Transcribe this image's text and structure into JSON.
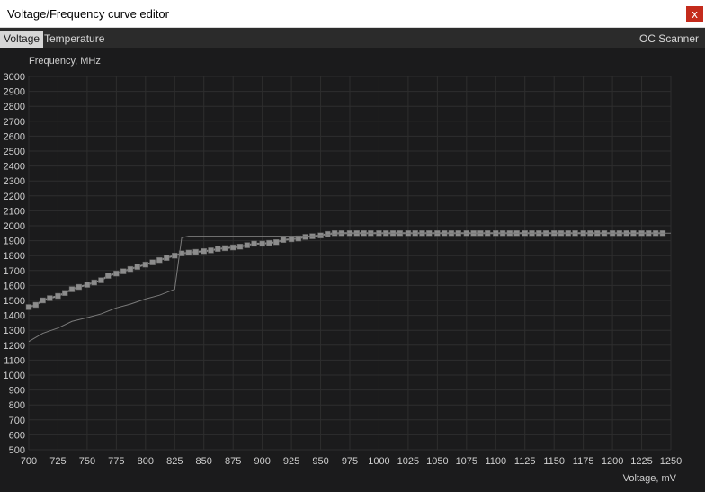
{
  "window": {
    "title": "Voltage/Frequency curve editor",
    "close_glyph": "x"
  },
  "tabs": {
    "voltage": "Voltage",
    "temperature": "Temperature",
    "oc_scanner": "OC Scanner"
  },
  "colors": {
    "background": "#1b1b1c",
    "grid": "#2e2e2e",
    "curve": "#8a8a8a",
    "marker": "#8c8c8c",
    "text": "#d0d0d0",
    "close": "#c42b1c"
  },
  "chart_data": {
    "type": "line",
    "ylabel": "Frequency, MHz",
    "xlabel": "Voltage, mV",
    "xlim": [
      700,
      1250
    ],
    "ylim": [
      500,
      3000
    ],
    "grid": true,
    "x_ticks": [
      700,
      725,
      750,
      775,
      800,
      825,
      850,
      875,
      900,
      925,
      950,
      975,
      1000,
      1025,
      1050,
      1075,
      1100,
      1125,
      1150,
      1175,
      1200,
      1225,
      1250
    ],
    "y_ticks": [
      500,
      600,
      700,
      800,
      900,
      1000,
      1100,
      1200,
      1300,
      1400,
      1500,
      1600,
      1700,
      1800,
      1900,
      2000,
      2100,
      2200,
      2300,
      2400,
      2500,
      2600,
      2700,
      2800,
      2900,
      3000
    ],
    "series": [
      {
        "style": "line-with-square-markers",
        "x": [
          700,
          706,
          712,
          718,
          725,
          731,
          737,
          743,
          750,
          756,
          762,
          768,
          775,
          781,
          787,
          793,
          800,
          806,
          812,
          818,
          825,
          831,
          837,
          843,
          850,
          856,
          862,
          868,
          875,
          881,
          887,
          893,
          900,
          906,
          912,
          918,
          925,
          931,
          937,
          943,
          950,
          956,
          962,
          968,
          975,
          981,
          987,
          993,
          1000,
          1006,
          1012,
          1018,
          1025,
          1031,
          1037,
          1043,
          1050,
          1056,
          1062,
          1068,
          1075,
          1081,
          1087,
          1093,
          1100,
          1106,
          1112,
          1118,
          1125,
          1131,
          1137,
          1143,
          1150,
          1156,
          1162,
          1168,
          1175,
          1181,
          1187,
          1193,
          1200,
          1206,
          1212,
          1218,
          1225,
          1231,
          1237,
          1243
        ],
        "y": [
          1455,
          1470,
          1500,
          1515,
          1530,
          1550,
          1575,
          1590,
          1605,
          1620,
          1635,
          1665,
          1680,
          1695,
          1710,
          1725,
          1740,
          1755,
          1770,
          1785,
          1800,
          1815,
          1820,
          1825,
          1830,
          1835,
          1845,
          1850,
          1855,
          1860,
          1870,
          1880,
          1880,
          1885,
          1890,
          1905,
          1910,
          1915,
          1925,
          1930,
          1935,
          1945,
          1950,
          1950,
          1950,
          1950,
          1950,
          1950,
          1950,
          1950,
          1950,
          1950,
          1950,
          1950,
          1950,
          1950,
          1950,
          1950,
          1950,
          1950,
          1950,
          1950,
          1950,
          1950,
          1950,
          1950,
          1950,
          1950,
          1950,
          1950,
          1950,
          1950,
          1950,
          1950,
          1950,
          1950,
          1950,
          1950,
          1950,
          1950,
          1950,
          1950,
          1950,
          1950,
          1950,
          1950,
          1950,
          1950
        ]
      },
      {
        "style": "thin-line",
        "x": [
          700,
          712,
          725,
          737,
          750,
          762,
          775,
          787,
          800,
          812,
          825,
          831,
          837,
          843,
          850,
          862,
          875,
          887,
          900,
          912,
          925,
          937,
          950,
          962,
          975,
          1000,
          1050,
          1100,
          1150,
          1200,
          1250
        ],
        "y": [
          1225,
          1280,
          1315,
          1360,
          1385,
          1410,
          1450,
          1475,
          1510,
          1535,
          1575,
          1920,
          1930,
          1930,
          1930,
          1930,
          1930,
          1930,
          1930,
          1930,
          1930,
          1930,
          1935,
          1945,
          1950,
          1950,
          1950,
          1950,
          1950,
          1950,
          1950
        ]
      }
    ]
  }
}
